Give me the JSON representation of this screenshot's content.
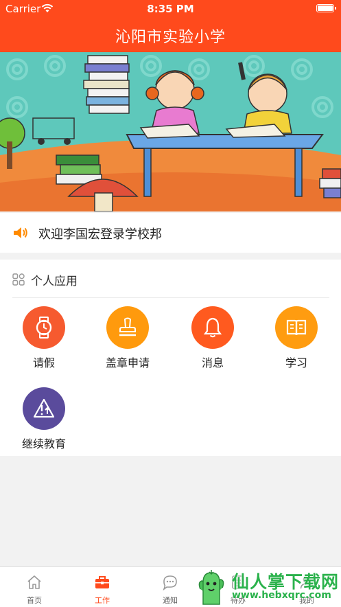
{
  "status_bar": {
    "carrier": "Carrier",
    "time": "8:35 PM"
  },
  "nav": {
    "title": "沁阳市实验小学"
  },
  "banner": {
    "image": "cartoon-kids-studying"
  },
  "notice": {
    "text": "欢迎李国宏登录学校邦"
  },
  "apps_section": {
    "title": "个人应用",
    "items": [
      {
        "label": "请假",
        "icon": "watch-icon",
        "color": "#f65a2f"
      },
      {
        "label": "盖章申请",
        "icon": "stamp-icon",
        "color": "#ff9a0d"
      },
      {
        "label": "消息",
        "icon": "bell-icon",
        "color": "#ff5a1f"
      },
      {
        "label": "学习",
        "icon": "book-icon",
        "color": "#ff9c10"
      },
      {
        "label": "继续教育",
        "icon": "warning-upload-icon",
        "color": "#5a4b9c"
      }
    ]
  },
  "tabbar": {
    "items": [
      {
        "label": "首页",
        "icon": "home-icon"
      },
      {
        "label": "工作",
        "icon": "briefcase-icon",
        "active": true
      },
      {
        "label": "通知",
        "icon": "chat-icon"
      },
      {
        "label": "待办",
        "icon": "todo-icon"
      },
      {
        "label": "我的",
        "icon": "user-icon"
      }
    ]
  },
  "watermark": {
    "title": "仙人掌下载网",
    "url": "www.hebxqrc.com"
  },
  "colors": {
    "primary": "#ff4a1c",
    "background": "#f2f2f2"
  }
}
